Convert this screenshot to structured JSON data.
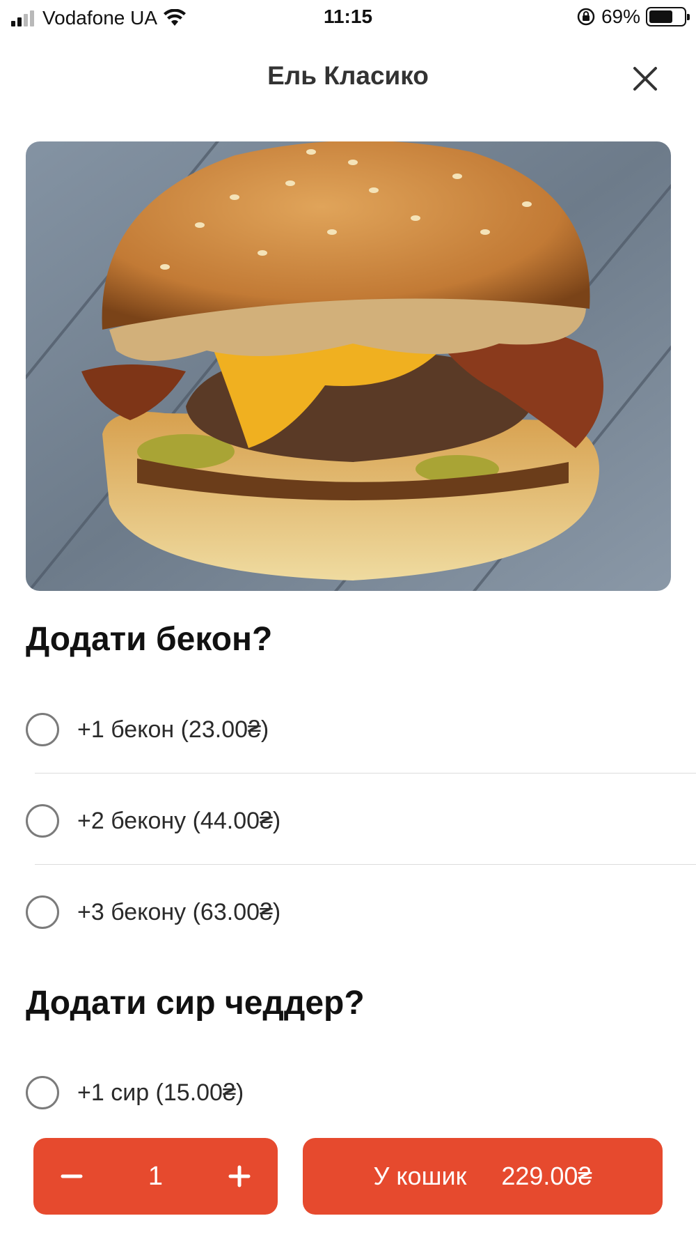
{
  "status_bar": {
    "carrier": "Vodafone UA",
    "time": "11:15",
    "battery": "69%",
    "battery_level": 0.69
  },
  "header": {
    "title": "Ель Класико",
    "close_icon": "close-icon"
  },
  "sections": [
    {
      "title": "Додати бекон?",
      "options": [
        {
          "label": "+1 бекон (23.00₴)",
          "selected": false
        },
        {
          "label": "+2 бекону (44.00₴)",
          "selected": false
        },
        {
          "label": "+3 бекону (63.00₴)",
          "selected": false
        }
      ]
    },
    {
      "title": "Додати сир чеддер?",
      "options": [
        {
          "label": "+1 сир (15.00₴)",
          "selected": false
        }
      ]
    }
  ],
  "bottom_bar": {
    "quantity": "1",
    "minus_icon": "minus-icon",
    "plus_icon": "plus-icon",
    "cart_label": "У кошик",
    "total": "229.00₴"
  },
  "colors": {
    "accent": "#e64a2e",
    "radio_border": "#7b7b7b",
    "divider": "#dcdcdc"
  }
}
